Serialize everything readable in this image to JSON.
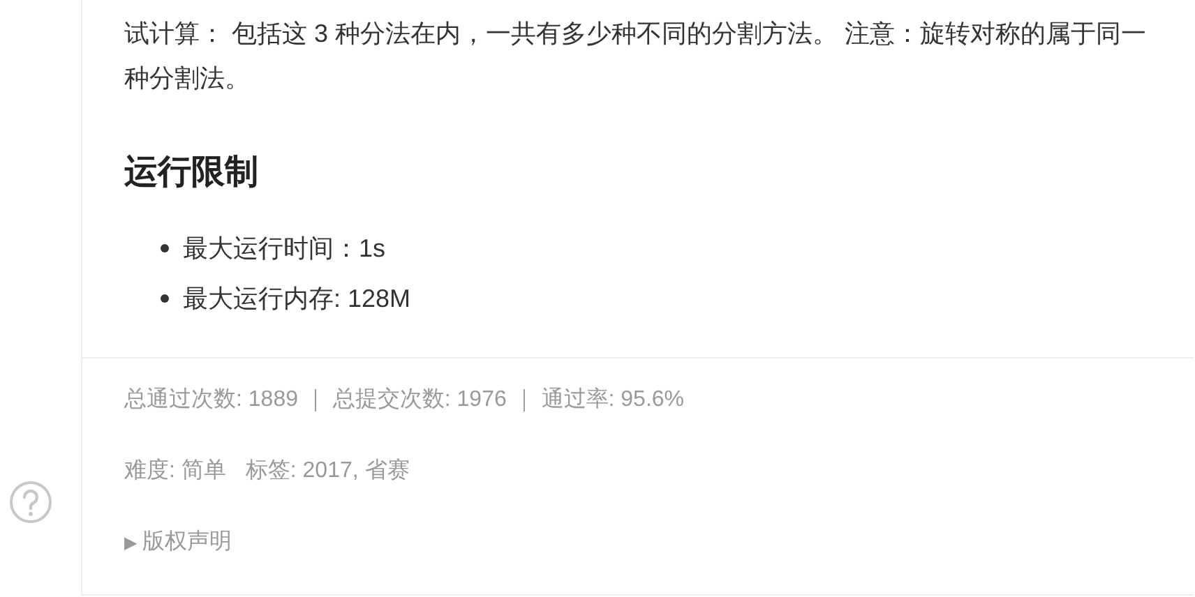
{
  "problem": {
    "paragraph": "试计算： 包括这 3 种分法在内，一共有多少种不同的分割方法。 注意：旋转对称的属于同一种分割法。",
    "limits_heading": "运行限制",
    "limits": [
      "最大运行时间：1s",
      "最大运行内存: 128M"
    ]
  },
  "stats": {
    "line": "总通过次数: 1889 ｜ 总提交次数: 1976 ｜ 通过率: 95.6%",
    "difficulty": "难度: 简单",
    "tags": "标签: 2017, 省赛"
  },
  "copyright": {
    "marker": "▶",
    "label": "版权声明",
    "expanded": false
  }
}
